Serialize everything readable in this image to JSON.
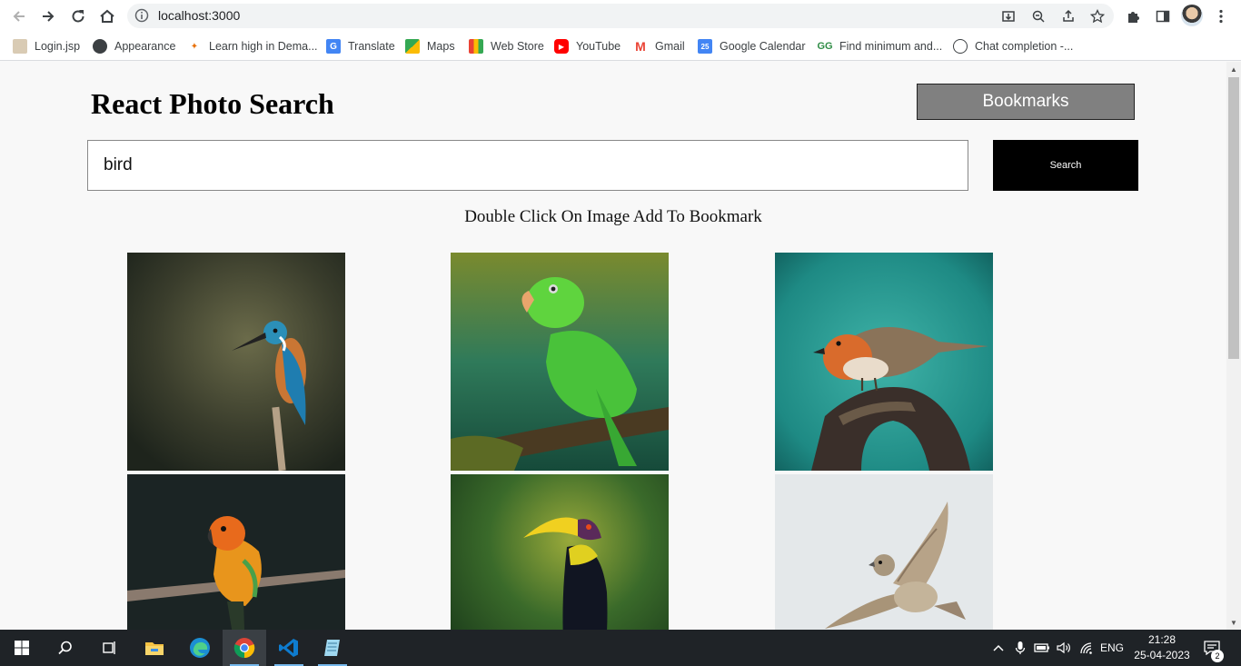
{
  "browser": {
    "url": "localhost:3000",
    "bookmarks": [
      "Login.jsp",
      "Appearance",
      "Learn high in Dema...",
      "Translate",
      "Maps",
      "Web Store",
      "YouTube",
      "Gmail",
      "Google Calendar",
      "Find minimum and...",
      "Chat completion -..."
    ]
  },
  "app": {
    "title": "React Photo Search",
    "bookmarks_button": "Bookmarks",
    "search_value": "bird",
    "search_button": "Search",
    "hint": "Double Click On Image Add To Bookmark",
    "photos": [
      "kingfisher",
      "green-parakeet",
      "robin",
      "sun-conure",
      "toucan",
      "sparrow-in-flight"
    ]
  },
  "taskbar": {
    "language": "ENG",
    "time": "21:28",
    "date": "25-04-2023",
    "notifications": "2"
  },
  "colors": {
    "page_bg": "#f8f8f8",
    "bookmarks_btn_bg": "#808080",
    "search_btn_bg": "#000000",
    "taskbar_bg": "#1f2327"
  }
}
